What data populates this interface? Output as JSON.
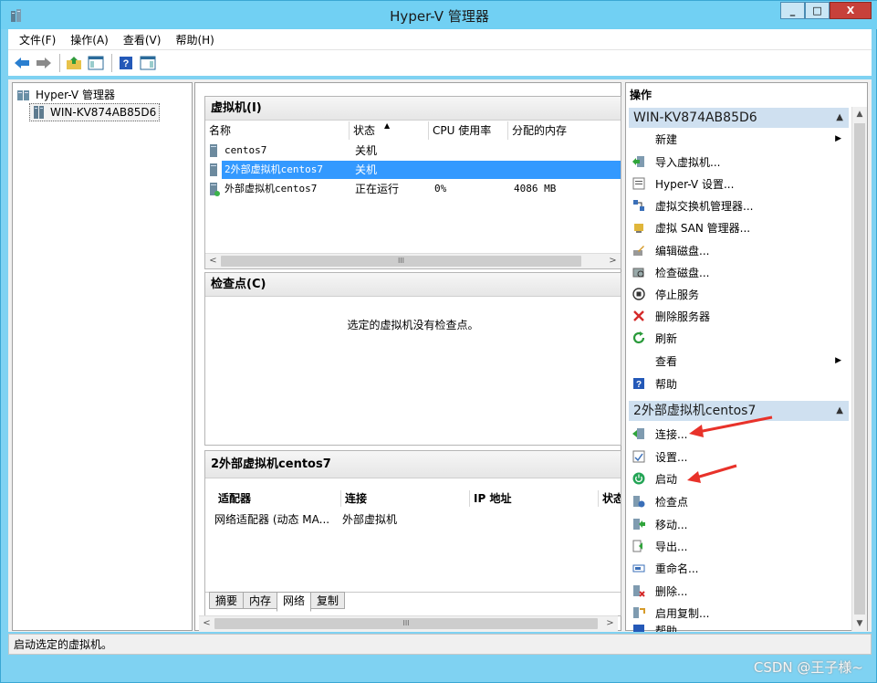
{
  "window": {
    "title": "Hyper-V 管理器",
    "minimize": "_",
    "maximize": "□",
    "close": "X"
  },
  "menu": [
    "文件(F)",
    "操作(A)",
    "查看(V)",
    "帮助(H)"
  ],
  "tree": {
    "root": "Hyper-V 管理器",
    "server": "WIN-KV874AB85D6"
  },
  "vms": {
    "header": "虚拟机(I)",
    "columns": [
      "名称",
      "状态",
      "CPU 使用率",
      "分配的内存"
    ],
    "rows": [
      {
        "name": "centos7",
        "state": "关机",
        "cpu": "",
        "mem": ""
      },
      {
        "name": "2外部虚拟机centos7",
        "state": "关机",
        "cpu": "",
        "mem": ""
      },
      {
        "name": "外部虚拟机centos7",
        "state": "正在运行",
        "cpu": "0%",
        "mem": "4086 MB"
      }
    ],
    "scroll_mark": "III"
  },
  "checkpoints": {
    "header": "检查点(C)",
    "empty_message": "选定的虚拟机没有检查点。"
  },
  "details": {
    "header": "2外部虚拟机centos7",
    "columns": [
      "适配器",
      "连接",
      "IP 地址",
      "状态"
    ],
    "row": {
      "adapter": "网络适配器 (动态 MA...",
      "connection": "外部虚拟机"
    },
    "tabs": [
      "摘要",
      "内存",
      "网络",
      "复制"
    ],
    "active_tab": "网络",
    "scroll_mark": "III"
  },
  "actions": {
    "title": "操作",
    "server_section": "WIN-KV874AB85D6",
    "server_items": [
      "新建",
      "导入虚拟机...",
      "Hyper-V 设置...",
      "虚拟交换机管理器...",
      "虚拟 SAN 管理器...",
      "编辑磁盘...",
      "检查磁盘...",
      "停止服务",
      "删除服务器",
      "刷新",
      "查看",
      "帮助"
    ],
    "vm_section": "2外部虚拟机centos7",
    "vm_items": [
      "连接...",
      "设置...",
      "启动",
      "检查点",
      "移动...",
      "导出...",
      "重命名...",
      "删除...",
      "启用复制...",
      "帮助"
    ]
  },
  "status": "启动选定的虚拟机。",
  "watermark": "CSDN @王子様~",
  "colors": {
    "title_bar": "#71d0f3",
    "selection": "#3399ff",
    "section_header": "#cfe0f0",
    "annotation_arrow": "#e8322a"
  }
}
